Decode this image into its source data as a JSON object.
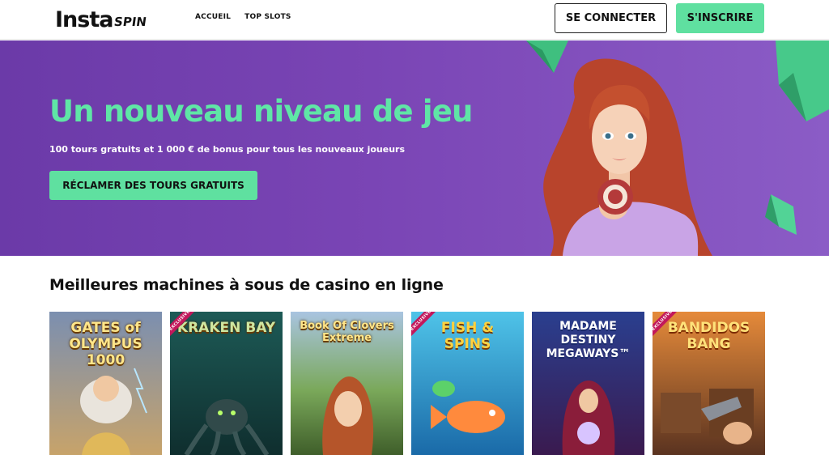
{
  "header": {
    "logo_main": "Insta",
    "logo_accent": "SPIN",
    "nav": [
      "ACCUEIL",
      "TOP SLOTS"
    ],
    "login_label": "SE CONNECTER",
    "signup_label": "S'INSCRIRE"
  },
  "hero": {
    "title": "Un nouveau niveau de jeu",
    "subtitle": "100 tours gratuits et 1 000 € de bonus pour tous les nouveaux joueurs",
    "cta_label": "RÉCLAMER DES TOURS GRATUITS"
  },
  "slots_section": {
    "title": "Meilleures machines à sous de casino en ligne",
    "ribbon_label": "EXCLUSIVE",
    "games": [
      {
        "name": "GATES of OLYMPUS 1000",
        "exclusive": false
      },
      {
        "name": "KRAKEN BAY",
        "exclusive": true
      },
      {
        "name": "Book Of Clovers Extreme",
        "exclusive": false
      },
      {
        "name": "FISH & SPINS",
        "exclusive": true
      },
      {
        "name": "MADAME DESTINY MEGAWAYS™",
        "exclusive": false
      },
      {
        "name": "BANDIDOS BANG",
        "exclusive": true
      }
    ]
  },
  "colors": {
    "accent_green": "#5fe0a0",
    "hero_purple": "#7a45b5"
  }
}
